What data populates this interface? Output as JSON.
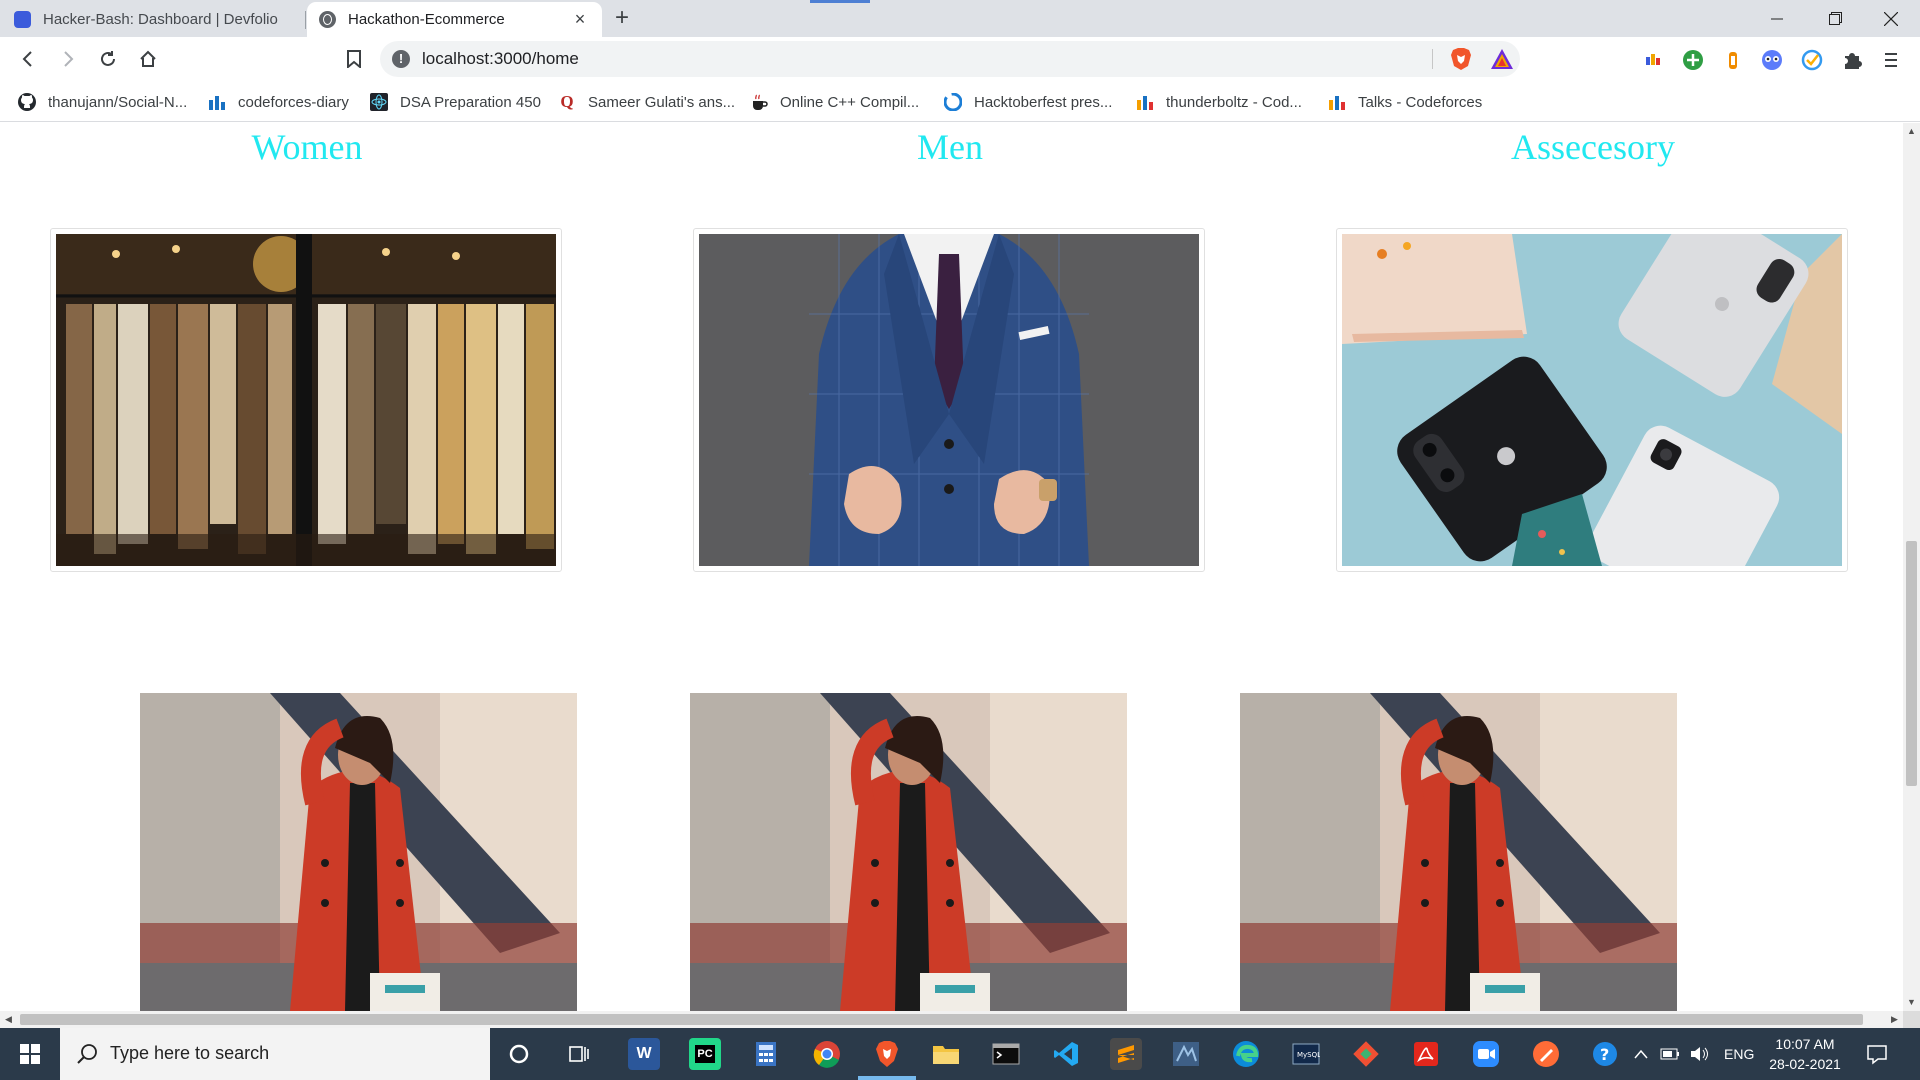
{
  "browser": {
    "tabs": [
      {
        "title": "Hacker-Bash: Dashboard | Devfolio",
        "active": false
      },
      {
        "title": "Hackathon-Ecommerce",
        "active": true
      }
    ],
    "url": "localhost:3000/home",
    "bookmarks": [
      {
        "label": "thanujann/Social-N...",
        "icon": "github-icon"
      },
      {
        "label": "codeforces-diary",
        "icon": "codeforces-icon"
      },
      {
        "label": "DSA Preparation 450",
        "icon": "react-icon"
      },
      {
        "label": "Sameer Gulati's ans...",
        "icon": "quora-icon"
      },
      {
        "label": "Online C++ Compil...",
        "icon": "coffee-icon"
      },
      {
        "label": "Hacktoberfest pres...",
        "icon": "hacktoberfest-icon"
      },
      {
        "label": "thunderboltz - Cod...",
        "icon": "codeforces-icon"
      },
      {
        "label": "Talks - Codeforces",
        "icon": "codeforces-icon"
      }
    ]
  },
  "page": {
    "categories": [
      {
        "title": "Women",
        "image": "clothing-rack-photo"
      },
      {
        "title": "Men",
        "image": "blue-suit-photo"
      },
      {
        "title": "Assecesory",
        "image": "smartphones-photo"
      }
    ],
    "promos": [
      {
        "image": "woman-red-coat-shopping-photo"
      },
      {
        "image": "woman-red-coat-shopping-photo"
      },
      {
        "image": "woman-red-coat-shopping-photo"
      }
    ],
    "accent_color": "#21e8f0"
  },
  "taskbar": {
    "search_placeholder": "Type here to search",
    "language": "ENG",
    "time": "10:07 AM",
    "date": "28-02-2021"
  }
}
